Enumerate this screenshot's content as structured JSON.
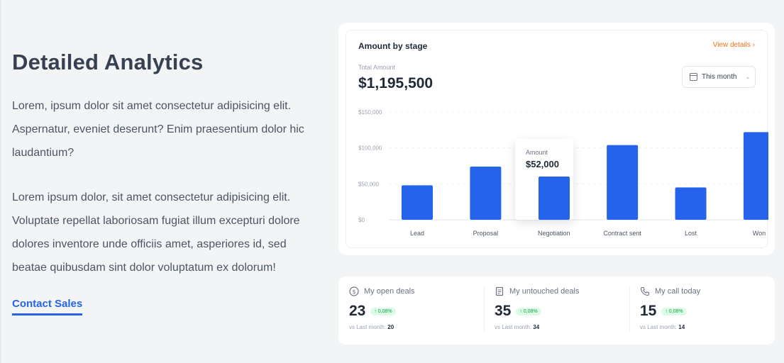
{
  "hero": {
    "title": "Detailed Analytics",
    "paragraph1": "Lorem, ipsum dolor sit amet consectetur adipisicing elit. Aspernatur, eveniet deserunt? Enim praesentium dolor hic laudantium?",
    "paragraph2": "Lorem ipsum dolor, sit amet consectetur adipisicing elit. Voluptate repellat laboriosam fugiat illum excepturi dolore dolores inventore unde officiis amet, asperiores id, sed beatae quibusdam sint dolor voluptatum ex dolorum!",
    "cta_label": "Contact Sales"
  },
  "chart_card": {
    "title": "Amount by stage",
    "view_details": "View details ›",
    "total_label": "Total Amount",
    "total_value": "$1,195,500",
    "period": "This month",
    "tooltip_label": "Amount",
    "tooltip_value": "$52,000"
  },
  "chart_data": {
    "type": "bar",
    "categories": [
      "Lead",
      "Proposal",
      "Negotiation",
      "Contract sent",
      "Lost",
      "Won"
    ],
    "values": [
      48000,
      74000,
      60000,
      104000,
      45000,
      122000
    ],
    "ylim": [
      0,
      150000
    ],
    "yticks": [
      0,
      50000,
      100000,
      150000
    ],
    "ytick_labels": [
      "$0",
      "$50,000",
      "$100,000",
      "$150,000"
    ],
    "bar_color": "#2563eb",
    "grid": true,
    "highlighted_category": "Negotiation"
  },
  "stats": [
    {
      "icon": "dollar-circle-icon",
      "label": "My open deals",
      "value": "23",
      "badge": "↑ 0,08%",
      "foot_label": "vs Last month:",
      "foot_value": "20"
    },
    {
      "icon": "document-icon",
      "label": "My untouched deals",
      "value": "35",
      "badge": "↑ 0,08%",
      "foot_label": "vs Last month:",
      "foot_value": "34"
    },
    {
      "icon": "phone-icon",
      "label": "My call today",
      "value": "15",
      "badge": "↑ 0,08%",
      "foot_label": "vs Last month:",
      "foot_value": "14"
    }
  ]
}
